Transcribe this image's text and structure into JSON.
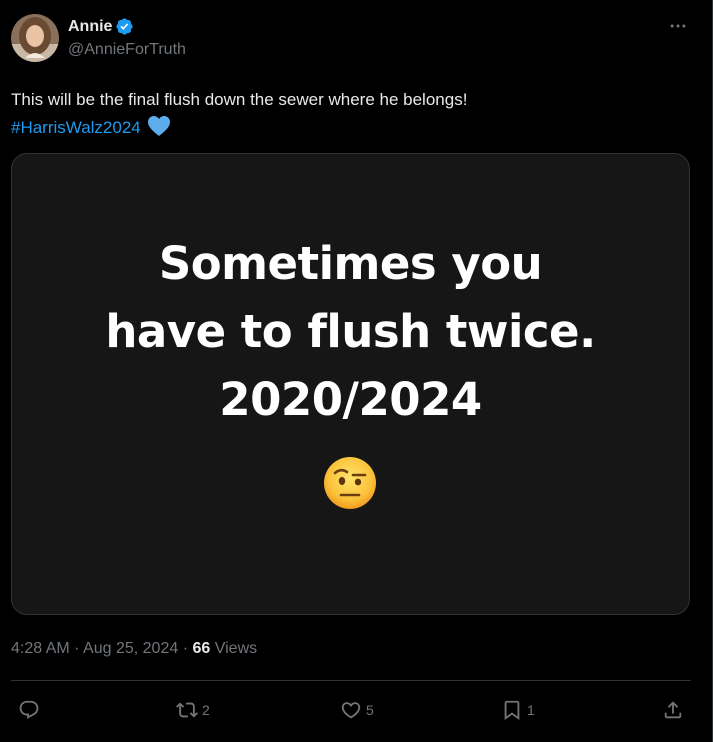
{
  "author": {
    "display_name": "Annie",
    "handle": "@AnnieForTruth",
    "avatar_icon": "profile-photo",
    "verified_icon": "verified-badge-icon",
    "verified_color": "#1d9bf0"
  },
  "post": {
    "text": "This will be the final flush down the sewer where he belongs!",
    "hashtag": "#HarrisWalz2024",
    "trailing_emoji": "blue-heart-icon"
  },
  "media": {
    "lines": [
      "Sometimes you",
      "have to flush twice.",
      "2020/2024"
    ],
    "emoji": "face-with-raised-eyebrow-icon"
  },
  "meta": {
    "time": "4:28 AM",
    "separator": "·",
    "date": "Aug 25, 2024",
    "views_count": "66",
    "views_label": "Views"
  },
  "actions": {
    "reply": {
      "icon": "reply-icon",
      "count": ""
    },
    "repost": {
      "icon": "repost-icon",
      "count": "2"
    },
    "like": {
      "icon": "heart-icon",
      "count": "5"
    },
    "bookmark": {
      "icon": "bookmark-icon",
      "count": "1"
    },
    "share": {
      "icon": "share-icon",
      "count": ""
    }
  },
  "colors": {
    "background": "#000000",
    "text_primary": "#e7e9ea",
    "text_secondary": "#71767b",
    "link": "#1d9bf0",
    "media_background": "#161616",
    "border": "#2f3336"
  }
}
